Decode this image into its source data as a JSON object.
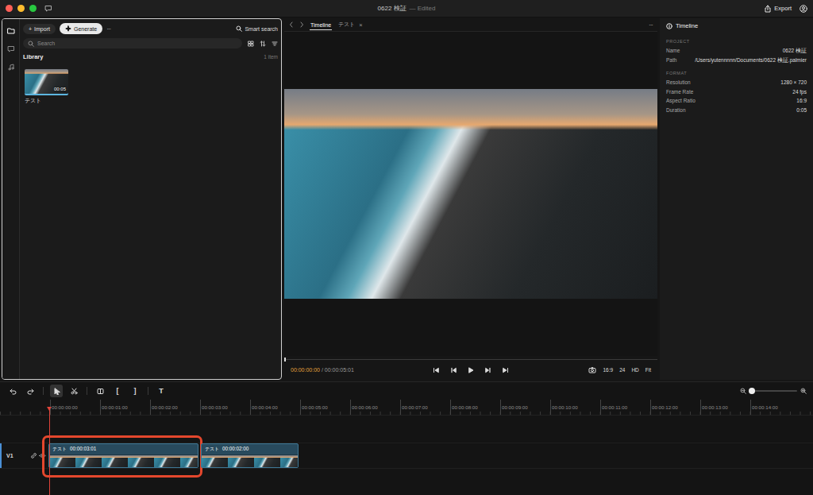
{
  "window": {
    "title": "0622 検証",
    "status": "— Edited",
    "export": "Export"
  },
  "rail": [
    {
      "selected": true
    },
    {
      "selected": false
    },
    {
      "selected": false
    }
  ],
  "library_toolbar": {
    "import": "Import",
    "import_plus": "+",
    "generate": "Generate",
    "more": "···",
    "smart_search": "Smart search"
  },
  "search": {
    "placeholder": "Search"
  },
  "library": {
    "title": "Library",
    "count": "1 item",
    "items": [
      {
        "name": "テスト",
        "duration": "00:05",
        "selected": true
      }
    ]
  },
  "viewer": {
    "tabs": [
      {
        "label": "Timeline",
        "selected": true
      },
      {
        "label": "テスト",
        "selected": false,
        "close": "×"
      }
    ],
    "more": "···",
    "current_time": "00:00:00:00",
    "separator": "/",
    "total_time": "00:00:05:01",
    "progress": 0,
    "settings": [
      "16:9",
      "24",
      "HD",
      "Fit"
    ]
  },
  "inspector": {
    "title": "Timeline",
    "sections": [
      {
        "heading": "PROJECT",
        "rows": [
          {
            "label": "Name",
            "value": "0622 検証"
          },
          {
            "label": "Path",
            "value": "/Users/yutennnnn/Documents/0622 検証.palmier"
          }
        ]
      },
      {
        "heading": "FORMAT",
        "rows": [
          {
            "label": "Resolution",
            "value": "1280 × 720"
          },
          {
            "label": "Frame Rate",
            "value": "24 fps"
          },
          {
            "label": "Aspect Ratio",
            "value": "16:9"
          },
          {
            "label": "Duration",
            "value": "0:05"
          }
        ]
      }
    ]
  },
  "timeline": {
    "tools": [
      {
        "selected": true
      },
      {
        "selected": false
      },
      {
        "selected": false
      },
      {
        "label": "[",
        "selected": false
      },
      {
        "label": "]",
        "selected": false
      },
      {
        "label": "T",
        "selected": false
      }
    ],
    "zoom": 0.05,
    "ruler": [
      "00:00:00:00",
      "00:00:01:00",
      "00:00:02:00",
      "00:00:03:00",
      "00:00:04:00",
      "00:00:05:00",
      "00:00:06:00",
      "00:00:07:00",
      "00:00:08:00",
      "00:00:09:00",
      "00:00:10:00",
      "00:00:11:00",
      "00:00:12:00",
      "00:00:13:00",
      "00:00:14:00"
    ],
    "tracks": [
      {
        "name": "V1",
        "clips": [
          {
            "label": "テスト",
            "duration": "00:00:03:01",
            "highlighted": true
          },
          {
            "label": "テスト",
            "duration": "00:00:02:00",
            "highlighted": false
          }
        ]
      }
    ]
  }
}
